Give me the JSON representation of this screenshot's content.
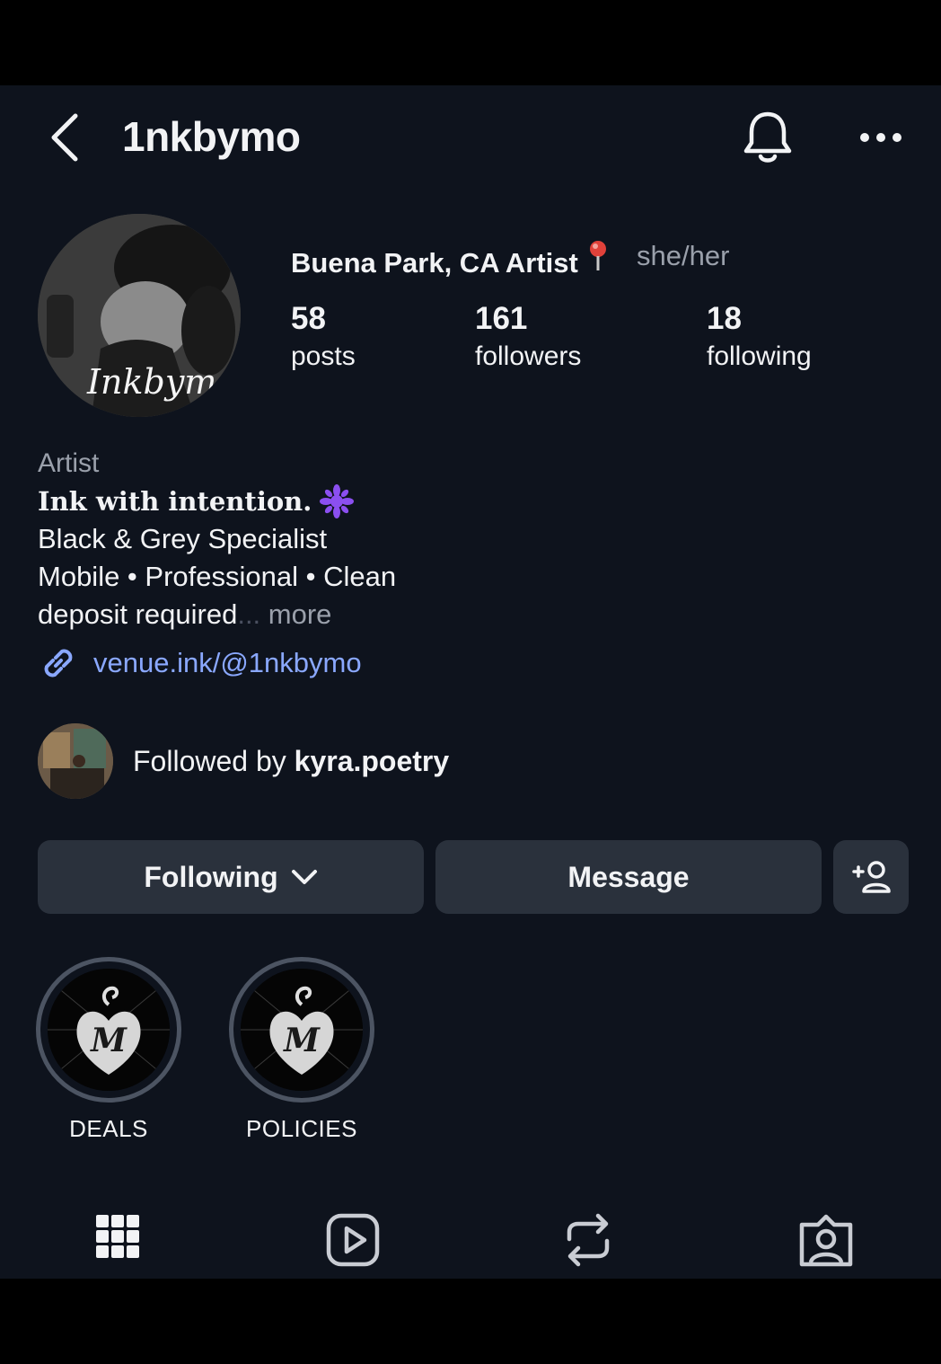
{
  "header": {
    "username": "1nkbymo"
  },
  "profile": {
    "location": "Buena Park, CA Artist",
    "pronouns": "she/her",
    "avatar_signature": "Inkbymo"
  },
  "stats": [
    {
      "value": "58",
      "label": "posts"
    },
    {
      "value": "161",
      "label": "followers"
    },
    {
      "value": "18",
      "label": "following"
    }
  ],
  "bio": {
    "category": "Artist",
    "tagline": "Ink with intention.",
    "lines": [
      "Black & Grey Specialist",
      "Mobile • Professional • Clean",
      "deposit required"
    ],
    "ellipsis": "...",
    "more_label": "more",
    "link": "venue.ink/@1nkbymo"
  },
  "followed_by": {
    "prefix": "Followed by",
    "name": "kyra.poetry"
  },
  "buttons": {
    "following": "Following",
    "message": "Message"
  },
  "highlights": [
    {
      "label": "DEALS"
    },
    {
      "label": "POLICIES"
    }
  ],
  "tabs": [
    "grid-icon",
    "reels-icon",
    "reposts-icon",
    "tagged-icon"
  ],
  "colors": {
    "background": "#0e131d",
    "button": "#2a313c",
    "link": "#8aa8ff",
    "muted": "#9aa0ab"
  }
}
